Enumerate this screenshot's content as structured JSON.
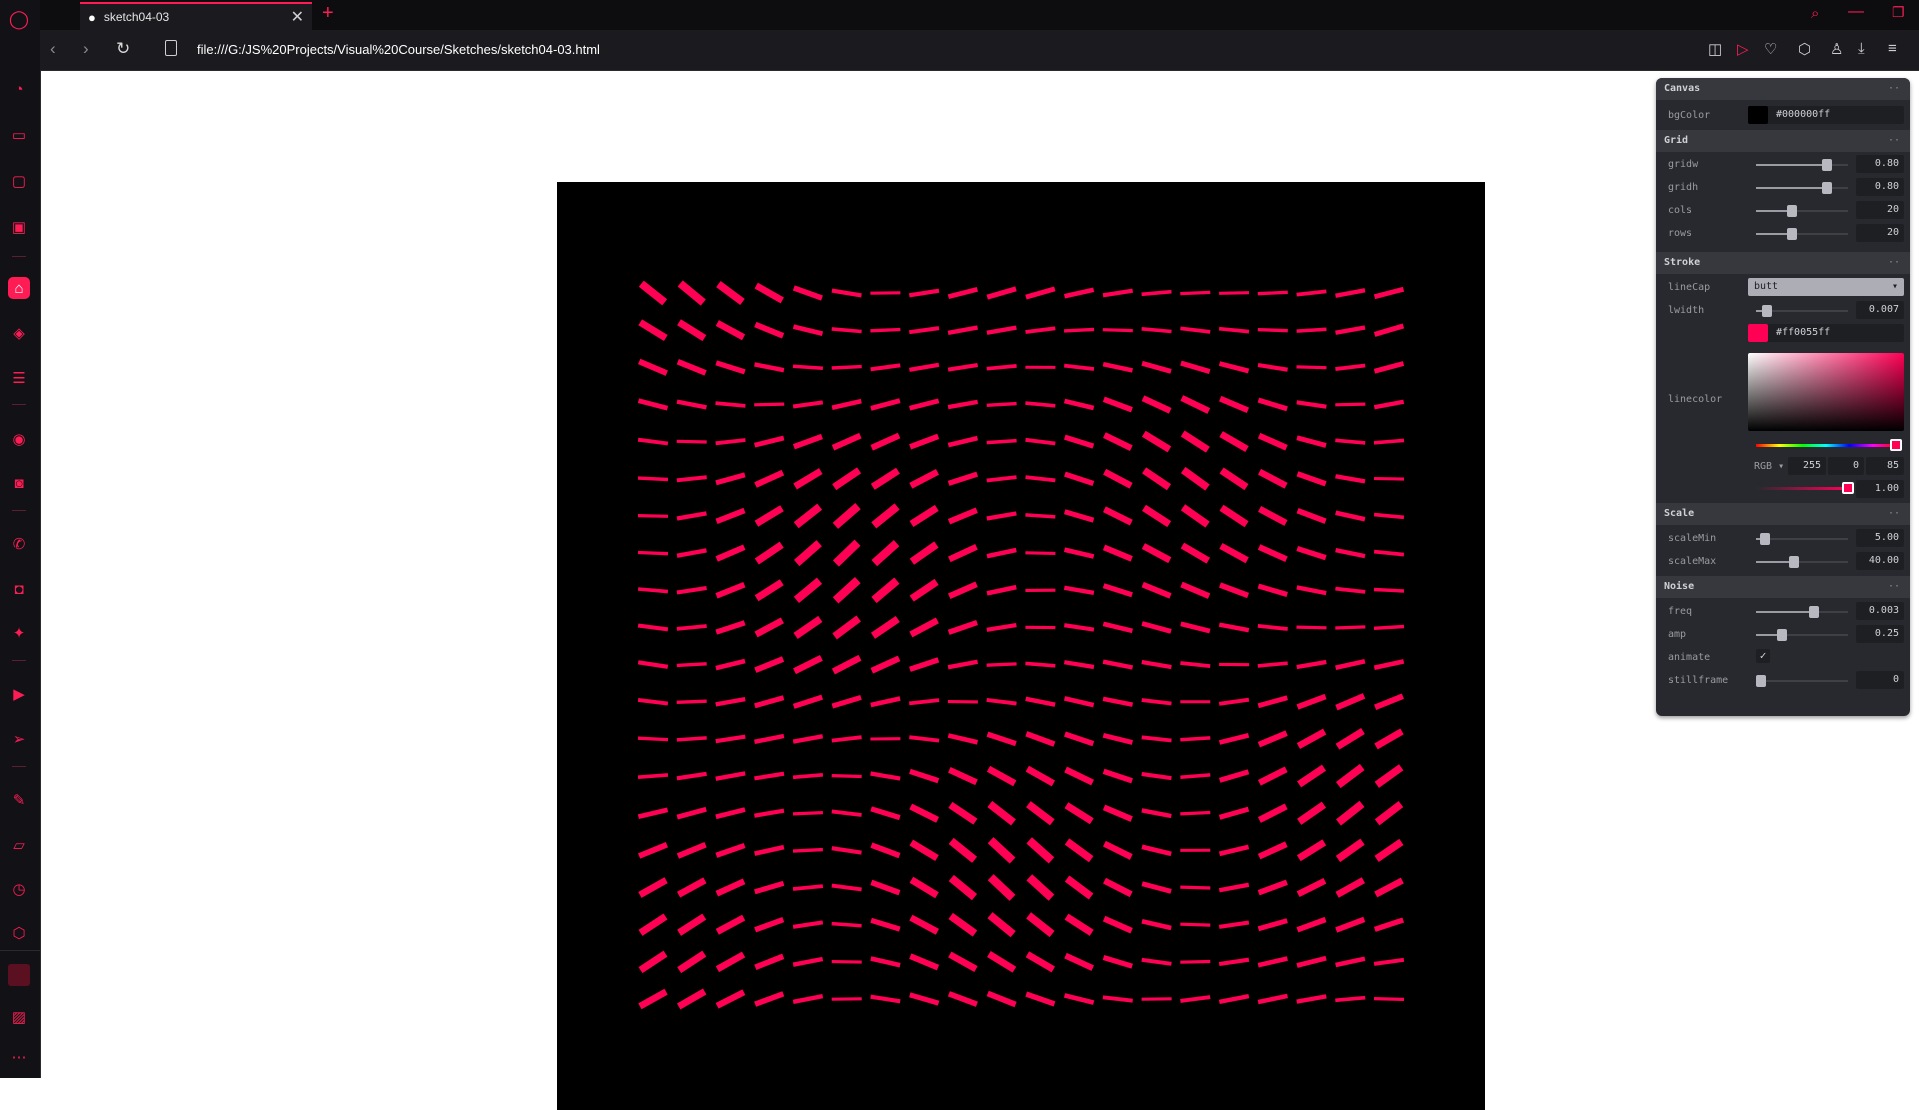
{
  "browser": {
    "tab_title": "sketch04-03",
    "url": "file:///G:/JS%20Projects/Visual%20Course/Sketches/sketch04-03.html",
    "accent_color": "#ff1c55"
  },
  "canvas": {
    "background": "#000000",
    "line_color": "#ff0055"
  },
  "pane": {
    "canvas_folder": {
      "title": "Canvas",
      "bgColor_label": "bgColor",
      "bgColor_value": "#000000ff"
    },
    "grid_folder": {
      "title": "Grid",
      "gridw_label": "gridw",
      "gridw_value": "0.80",
      "gridw_fraction": 0.8,
      "gridh_label": "gridh",
      "gridh_value": "0.80",
      "gridh_fraction": 0.8,
      "cols_label": "cols",
      "cols_value": "20",
      "cols_fraction": 0.38,
      "rows_label": "rows",
      "rows_value": "20",
      "rows_fraction": 0.38
    },
    "stroke_folder": {
      "title": "Stroke",
      "linecap_label": "lineCap",
      "linecap_value": "butt",
      "lwidth_label": "lwidth",
      "lwidth_value": "0.007",
      "lwidth_fraction": 0.07,
      "linecolor_label": "linecolor",
      "linecolor_value": "#ff0055ff",
      "color_mode": "RGB",
      "r": "255",
      "g": "0",
      "b": "85",
      "alpha": "1.00",
      "alpha_fraction": 1.0
    },
    "scale_folder": {
      "title": "Scale",
      "scaleMin_label": "scaleMin",
      "scaleMin_value": "5.00",
      "scaleMin_fraction": 0.05,
      "scaleMax_label": "scaleMax",
      "scaleMax_value": "40.00",
      "scaleMax_fraction": 0.4
    },
    "noise_folder": {
      "title": "Noise",
      "freq_label": "freq",
      "freq_value": "0.003",
      "freq_fraction": 0.65,
      "amp_label": "amp",
      "amp_value": "0.25",
      "amp_fraction": 0.25,
      "animate_label": "animate",
      "animate_checked": true,
      "stillframe_label": "stillframe",
      "stillframe_value": "0",
      "stillframe_fraction": 0.0
    }
  }
}
